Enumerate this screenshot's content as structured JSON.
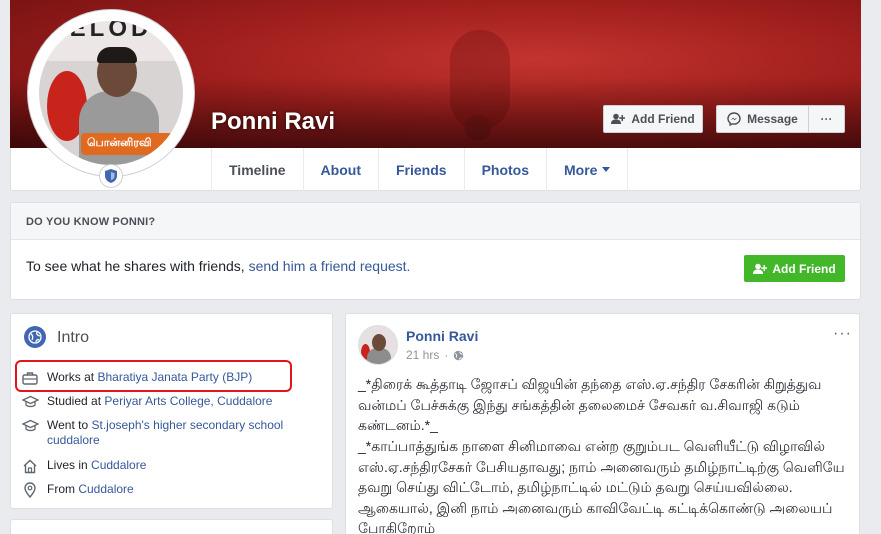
{
  "profile": {
    "name": "Ponni Ravi",
    "pic_title_text": "IELOD",
    "pic_banner_text": "பொன்னிரவி"
  },
  "cover_buttons": {
    "add_friend": "Add Friend",
    "message": "Message",
    "more": "···"
  },
  "tabs": [
    {
      "label": "Timeline"
    },
    {
      "label": "About"
    },
    {
      "label": "Friends"
    },
    {
      "label": "Photos"
    },
    {
      "label": "More"
    }
  ],
  "know": {
    "title": "DO YOU KNOW PONNI?",
    "text": "To see what he shares with friends,",
    "link": "send him a friend request.",
    "button": "Add Friend"
  },
  "intro": {
    "title": "Intro",
    "items": [
      {
        "icon": "briefcase-icon",
        "prefix": "Works at",
        "link": "Bharatiya Janata Party (BJP)"
      },
      {
        "icon": "graduation-cap-icon",
        "prefix": "Studied at",
        "link": "Periyar Arts College, Cuddalore"
      },
      {
        "icon": "graduation-cap-icon",
        "prefix": "Went to",
        "link": "St.joseph's higher secondary school cuddalore"
      },
      {
        "icon": "home-icon",
        "prefix": "Lives in",
        "link": "Cuddalore"
      },
      {
        "icon": "location-pin-icon",
        "prefix": "From",
        "link": "Cuddalore"
      }
    ]
  },
  "post": {
    "author": "Ponni Ravi",
    "time": "21 hrs",
    "dots": "···",
    "paragraph_1": "_*திரைக் கூத்தாடி ஜோசப் விஜயின் தந்தை எஸ்.ஏ.சந்திர சேகரின் கிறுத்துவ வன்மப் பேச்சுக்கு இந்து சங்கத்தின் தலைமைச் சேவகர் வ.சிவாஜி கடும் கண்டனம்.*_",
    "paragraph_2": "_*காப்பாத்துங்க நாளை சினிமாவை என்ற குறும்பட வெளியீட்டு விழாவில் எஸ்.ஏ.சந்திரசேகர் பேசியதாவது; நாம் அனைவரும் தமிழ்நாட்டிற்கு வெளியே தவறு செய்து விட்டோம், தமிழ்நாட்டில் மட்டும் தவறு செய்யவில்லை. ஆகையால், இனி நாம் அனைவரும் காவிவேட்டி கட்டிக்கொண்டு அலையப் போகிறோம்"
  },
  "colors": {
    "fb_blue": "#365899",
    "green": "#42b72a",
    "highlight_red": "#e0151f"
  }
}
